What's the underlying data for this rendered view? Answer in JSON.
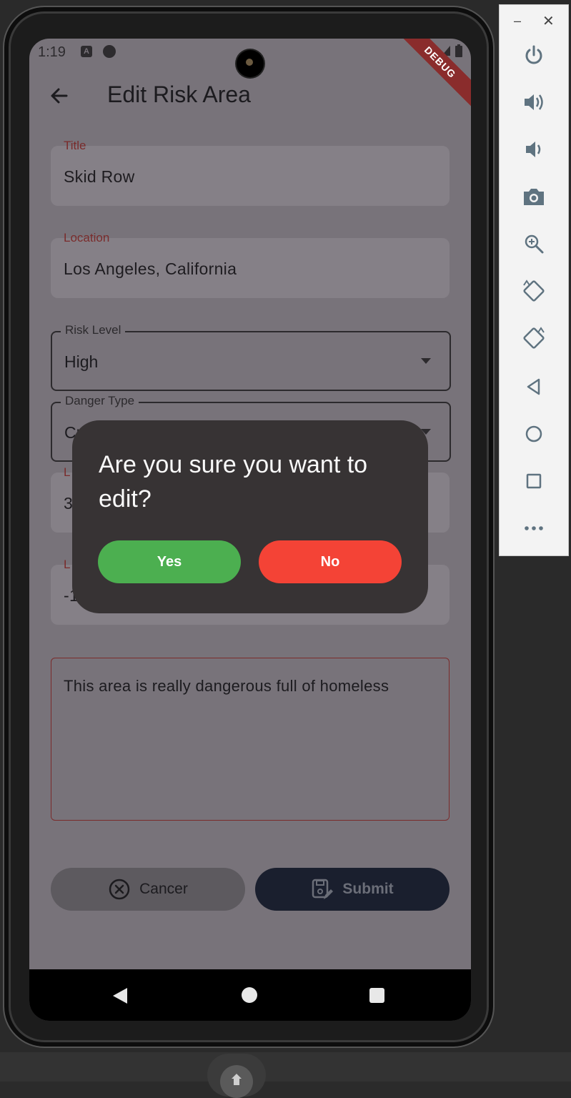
{
  "status_bar": {
    "time": "1:19",
    "icon_a": "A",
    "debug_banner": "DEBUG"
  },
  "app_bar": {
    "title": "Edit Risk Area"
  },
  "form": {
    "title": {
      "label": "Title",
      "value": "Skid Row"
    },
    "location": {
      "label": "Location",
      "value": "Los Angeles, California"
    },
    "risk_level": {
      "label": "Risk Level",
      "value": "High"
    },
    "danger_type": {
      "label": "Danger Type",
      "value_partial": "Cr"
    },
    "latitude": {
      "label_partial": "L",
      "value_partial": "3"
    },
    "longitude": {
      "label_partial": "L",
      "value_partial": "-1"
    },
    "description": {
      "value": "This area is really dangerous full of homeless"
    }
  },
  "actions": {
    "cancel_label": "Cancer",
    "submit_label": "Submit"
  },
  "dialog": {
    "message": "Are you sure you want to edit?",
    "yes_label": "Yes",
    "no_label": "No"
  },
  "emulator_toolbar": {
    "window_controls": [
      "minimize",
      "close"
    ],
    "tools": [
      "power-icon",
      "volume-up-icon",
      "volume-down-icon",
      "camera-icon",
      "zoom-icon",
      "rotate-left-icon",
      "rotate-right-icon",
      "back-icon",
      "home-icon",
      "overview-icon",
      "more-icon"
    ]
  },
  "colors": {
    "yes": "#4caf50",
    "no": "#f44336",
    "dialog_bg": "#373334",
    "submit_bg": "#1a1f2e",
    "label_accent": "#7a2b2b"
  }
}
